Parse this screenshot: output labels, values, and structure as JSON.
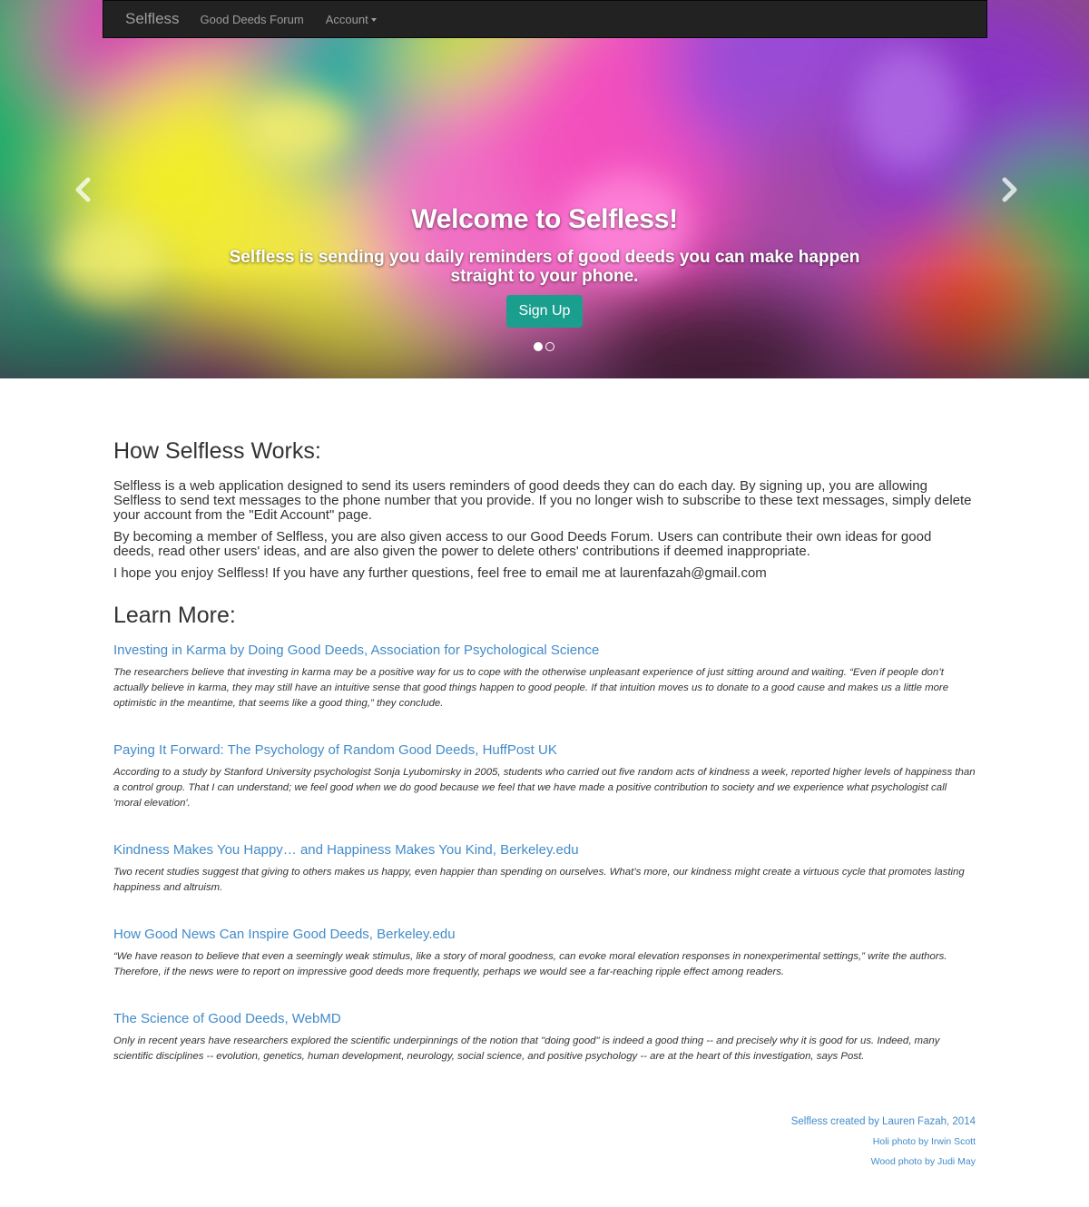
{
  "navbar": {
    "brand": "Selfless",
    "links": [
      {
        "label": "Good Deeds Forum"
      },
      {
        "label": "Account"
      }
    ]
  },
  "hero": {
    "title": "Welcome to Selfless!",
    "subtitle": "Selfless is sending you daily reminders of good deeds you can make happen straight to your phone.",
    "cta": "Sign Up",
    "slides_total": 2,
    "active_slide": 1
  },
  "about": {
    "heading": "How Selfless Works:",
    "paragraphs": [
      "Selfless is a web application designed to send its users reminders of good deeds they can do each day. By signing up, you are allowing Selfless to send text messages to the phone number that you provide. If you no longer wish to subscribe to these text messages, simply delete your account from the \"Edit Account\" page.",
      "By becoming a member of Selfless, you are also given access to our Good Deeds Forum. Users can contribute their own ideas for good deeds, read other users' ideas, and are also given the power to delete others' contributions if deemed inappropriate.",
      "I hope you enjoy Selfless! If you have any further questions, feel free to email me at laurenfazah@gmail.com"
    ]
  },
  "learn_more": {
    "heading": "Learn More:",
    "articles": [
      {
        "title": "Investing in Karma by Doing Good Deeds, Association for Psychological Science",
        "quote": "The researchers believe that investing in karma may be a positive way for us to cope with the otherwise unpleasant experience of just sitting around and waiting. “Even if people don’t actually believe in karma, they may still have an intuitive sense that good things happen to good people. If that intuition moves us to donate to a good cause and makes us a little more optimistic in the meantime, that seems like a good thing,” they conclude."
      },
      {
        "title": "Paying It Forward: The Psychology of Random Good Deeds, HuffPost UK",
        "quote": "According to a study by Stanford University psychologist Sonja Lyubomirsky in 2005, students who carried out five random acts of kindness a week, reported higher levels of happiness than a control group. That I can understand; we feel good when we do good because we feel that we have made a positive contribution to society and we experience what psychologist call 'moral elevation'."
      },
      {
        "title": "Kindness Makes You Happy… and Happiness Makes You Kind, Berkeley.edu",
        "quote": "Two recent studies suggest that giving to others makes us happy, even happier than spending on ourselves. What’s more, our kindness might create a virtuous cycle that promotes lasting happiness and altruism."
      },
      {
        "title": "How Good News Can Inspire Good Deeds, Berkeley.edu",
        "quote": "“We have reason to believe that even a seemingly weak stimulus, like a story of moral goodness, can evoke moral elevation responses in nonexperimental settings,” write the authors. Therefore, if the news were to report on impressive good deeds more frequently, perhaps we would see a far-reaching ripple effect among readers."
      },
      {
        "title": "The Science of Good Deeds, WebMD",
        "quote": "Only in recent years have researchers explored the scientific underpinnings of the notion that \"doing good\" is indeed a good thing -- and precisely why it is good for us. Indeed, many scientific disciplines -- evolution, genetics, human development, neurology, social science, and positive psychology -- are at the heart of this investigation, says Post."
      }
    ]
  },
  "footer": {
    "credit": "Selfless created by Lauren Fazah, 2014",
    "photo_credits": [
      "Holi photo by Irwin Scott",
      "Wood photo by Judi May"
    ]
  },
  "colors": {
    "link": "#428bca",
    "navbar_bg": "#222222",
    "cta_bg": "#1a9e8e",
    "text": "#333333"
  },
  "icons": {
    "prev": "chevron-left-icon",
    "next": "chevron-right-icon",
    "dropdown": "caret-down-icon"
  }
}
